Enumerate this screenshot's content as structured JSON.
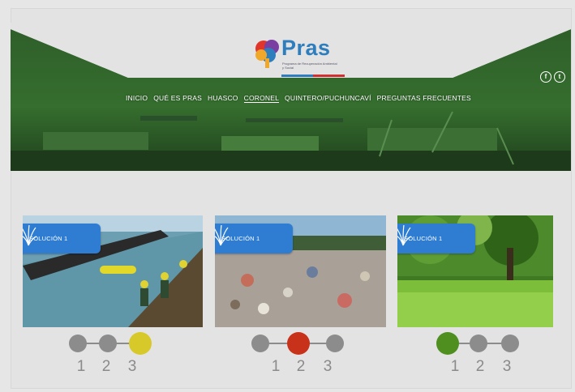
{
  "brand": {
    "name": "Pras",
    "tagline": "Programa de Recuperación Ambiental y Social"
  },
  "social": [
    "f",
    "t"
  ],
  "nav": {
    "items": [
      "INICIO",
      "QUÉ ES PRAS",
      "HUASCO",
      "CORONEL",
      "QUINTERO/PUCHUNCAVÍ",
      "PREGUNTAS FRECUENTES"
    ],
    "active": "CORONEL"
  },
  "cards": [
    {
      "badge": "SOLUCIÓN 1",
      "scene": "pipeline-water",
      "active_step": 3,
      "active_color": "#d8c92a",
      "steps": [
        "1",
        "2",
        "3"
      ]
    },
    {
      "badge": "SOLUCIÓN 1",
      "scene": "garbage-dump",
      "active_step": 2,
      "active_color": "#c8321b",
      "steps": [
        "1",
        "2",
        "3"
      ]
    },
    {
      "badge": "SOLUCIÓN 1",
      "scene": "green-park",
      "active_step": 1,
      "active_color": "#4f8f1f",
      "steps": [
        "1",
        "2",
        "3"
      ]
    }
  ],
  "colors": {
    "banner_green": "#2f6b2a",
    "badge_blue": "#2e7dd3",
    "inactive_dot": "#8c8c8c"
  }
}
